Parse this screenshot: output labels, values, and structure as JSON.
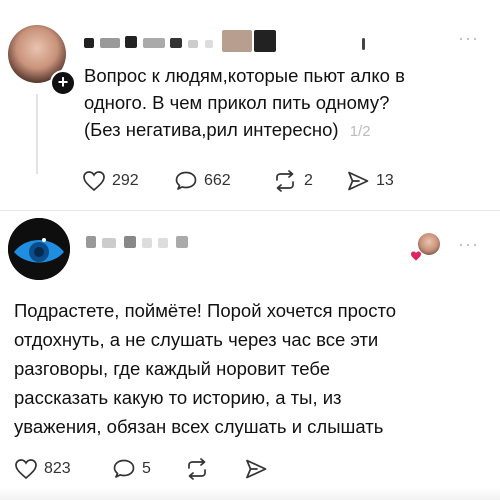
{
  "post": {
    "username_hidden": "",
    "text_line1": "Вопрос к людям,которые пьют алко в",
    "text_line2": "одного. В чем прикол пить одному?",
    "text_line3": "(Без негатива,рил интересно)",
    "page_indicator": "1/2",
    "actions": {
      "likes": "292",
      "comments": "662",
      "reposts": "2",
      "shares": "13"
    },
    "more_label": "···"
  },
  "reply": {
    "username_hidden": "",
    "text_lines": [
      "Подрастете, поймёте!  Порой хочется просто",
      "отдохнуть, а не слушать через час все эти",
      "разговоры, где каждый норовит тебе",
      "рассказать какую то историю, а ты, из",
      "уважения, обязан всех слушать и слышать"
    ],
    "actions": {
      "likes": "823",
      "comments": "5"
    },
    "more_label": "···"
  },
  "colors": {
    "text": "#111111",
    "muted": "#bbbbbb",
    "like_heart": "#e0245e",
    "reply_avatar_bg": "#1f8ee0"
  },
  "icons": [
    "heart-icon",
    "comment-icon",
    "repost-icon",
    "share-icon",
    "plus-icon",
    "more-icon"
  ]
}
